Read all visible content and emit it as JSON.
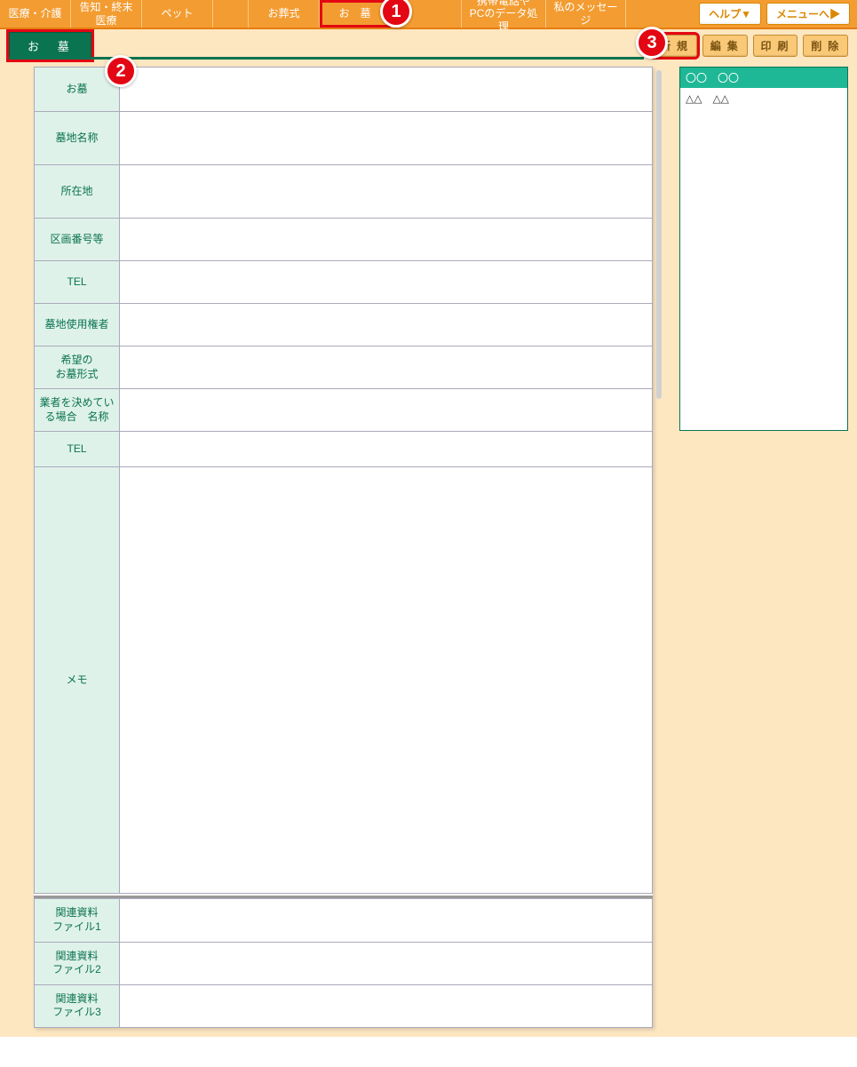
{
  "nav": {
    "tabs": [
      "医療・介護",
      "告知・終末医療",
      "ペット",
      "",
      "お葬式",
      "お　墓",
      "",
      "携帯電話や\nPCのデータ処理",
      "私のメッセージ"
    ],
    "active_index": 5,
    "help_label": "ヘルプ▼",
    "menu_label": "メニューへ▶"
  },
  "sub": {
    "tab_label": "お　墓",
    "actions": {
      "new": "新 規",
      "edit": "編 集",
      "print": "印 刷",
      "delete": "削 除"
    }
  },
  "form": {
    "rows": [
      {
        "label": "お墓",
        "value": "",
        "cls": "h-first"
      },
      {
        "label": "墓地名称",
        "value": "",
        "cls": "h-tall"
      },
      {
        "label": "所在地",
        "value": "",
        "cls": "h-tall"
      },
      {
        "label": "区画番号等",
        "value": "",
        "cls": "h-normal"
      },
      {
        "label": "TEL",
        "value": "",
        "cls": "h-normal"
      },
      {
        "label": "墓地使用権者",
        "value": "",
        "cls": "h-normal"
      },
      {
        "label": "希望の\nお墓形式",
        "value": "",
        "cls": "h-normal"
      },
      {
        "label": "業者を決めてい\nる場合　名称",
        "value": "",
        "cls": "h-normal"
      },
      {
        "label": "TEL",
        "value": "",
        "cls": "h-short"
      },
      {
        "label": "メモ",
        "value": "",
        "cls": "h-memo"
      }
    ],
    "file_rows": [
      {
        "label": "関連資料\nファイル1",
        "value": ""
      },
      {
        "label": "関連資料\nファイル2",
        "value": ""
      },
      {
        "label": "関連資料\nファイル3",
        "value": ""
      }
    ]
  },
  "side": {
    "items": [
      {
        "text": "〇〇　〇〇",
        "selected": true
      },
      {
        "text": "△△　△△",
        "selected": false
      }
    ]
  },
  "callouts": {
    "c1": "1",
    "c2": "2",
    "c3": "3"
  }
}
